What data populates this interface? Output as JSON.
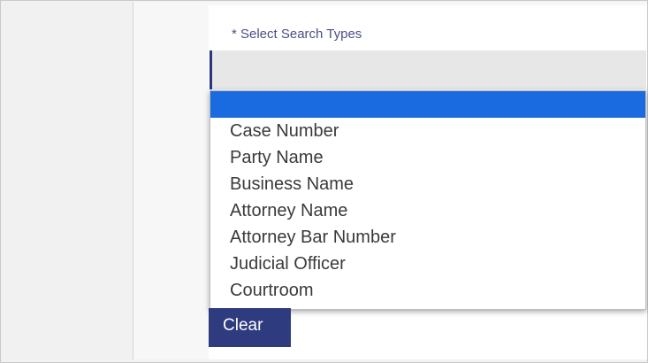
{
  "form": {
    "search_types_label": "* Select Search Types",
    "select_value": ""
  },
  "dropdown": {
    "options": [
      "",
      "Case Number",
      "Party Name",
      "Business Name",
      "Attorney Name",
      "Attorney Bar Number",
      "Judicial Officer",
      "Courtroom"
    ],
    "highlight_color": "#1a6be0"
  },
  "actions": {
    "clear_label": "Clear"
  },
  "colors": {
    "accent": "#2f3b7f"
  }
}
